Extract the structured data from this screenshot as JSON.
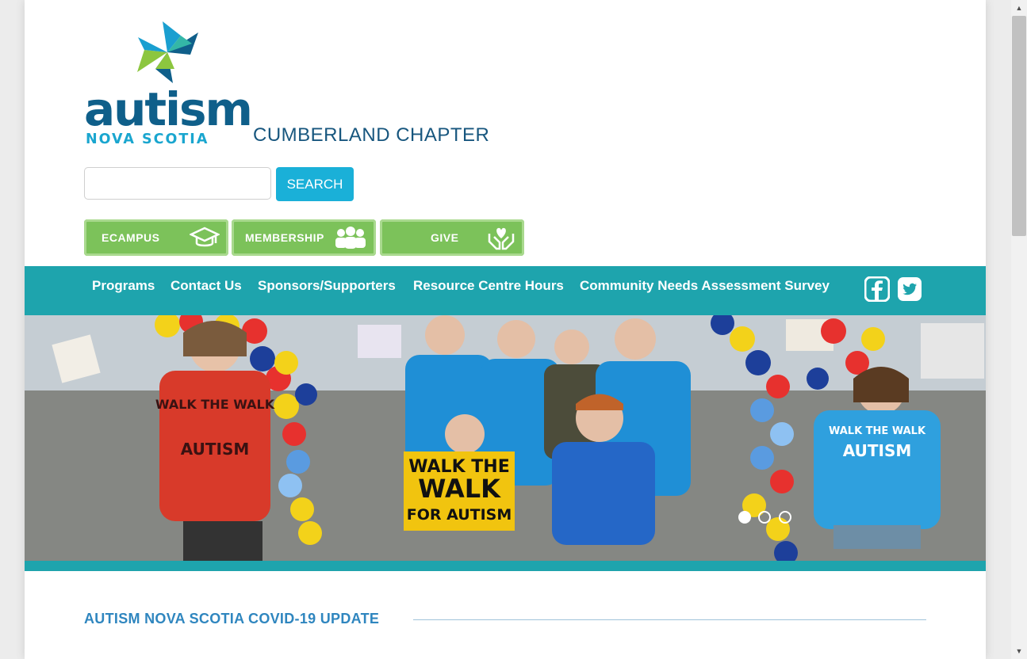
{
  "brand": {
    "logo_word": "autism",
    "logo_sub": "NOVA SCOTIA",
    "chapter": "CUMBERLAND CHAPTER",
    "colors": {
      "navy": "#0f5f8a",
      "teal": "#1ea4ad",
      "green": "#7cc25a",
      "sky": "#1ab0d8"
    }
  },
  "search": {
    "placeholder": "",
    "button_label": "SEARCH"
  },
  "quick_links": [
    {
      "label": "ECAMPUS",
      "icon": "graduation-cap-icon"
    },
    {
      "label": "MEMBERSHIP",
      "icon": "people-group-icon"
    },
    {
      "label": "GIVE",
      "icon": "hands-heart-icon"
    }
  ],
  "nav": {
    "items": [
      {
        "label": "Programs"
      },
      {
        "label": "Contact Us"
      },
      {
        "label": "Sponsors/Supporters"
      },
      {
        "label": "Resource Centre Hours"
      },
      {
        "label": "Community Needs Assessment Survey"
      }
    ],
    "social": [
      "facebook-icon",
      "twitter-icon"
    ]
  },
  "hero": {
    "slide_count": 3,
    "active_slide": 1,
    "sign_text": [
      "WALK THE",
      "WALK",
      "FOR AUTISM"
    ],
    "shirt_text": [
      "WALK THE WALK",
      "AUTISM"
    ]
  },
  "section": {
    "title": "AUTISM NOVA SCOTIA COVID-19 UPDATE"
  }
}
